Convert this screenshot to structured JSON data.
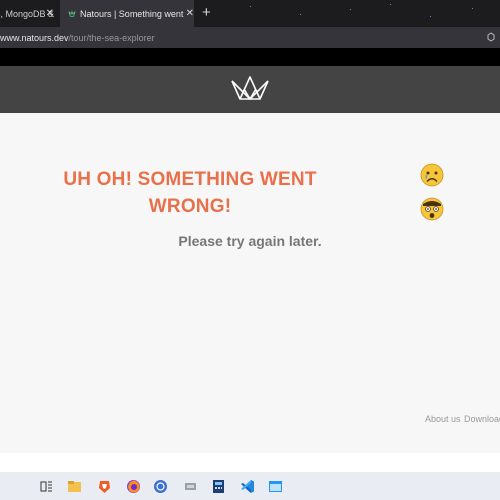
{
  "browser": {
    "tabs": [
      {
        "label": "s, MongoDB & N",
        "active": false
      },
      {
        "label": "Natours | Something went wrong",
        "active": true
      }
    ],
    "url_host": "www.natours.dev",
    "url_path": "/tour/the-sea-explorer"
  },
  "page": {
    "error_title": "UH OH! SOMETHING WENT WRONG!",
    "error_message": "Please try again later.",
    "footer": [
      "About us",
      "Download"
    ]
  },
  "icons": {
    "logo": "natours-crown-logo",
    "emoji_1": "sad-face-emoji",
    "emoji_2": "shocked-face-emoji"
  },
  "colors": {
    "accent": "#e8704a",
    "header": "#444444",
    "page_bg": "#f7f7f7"
  }
}
